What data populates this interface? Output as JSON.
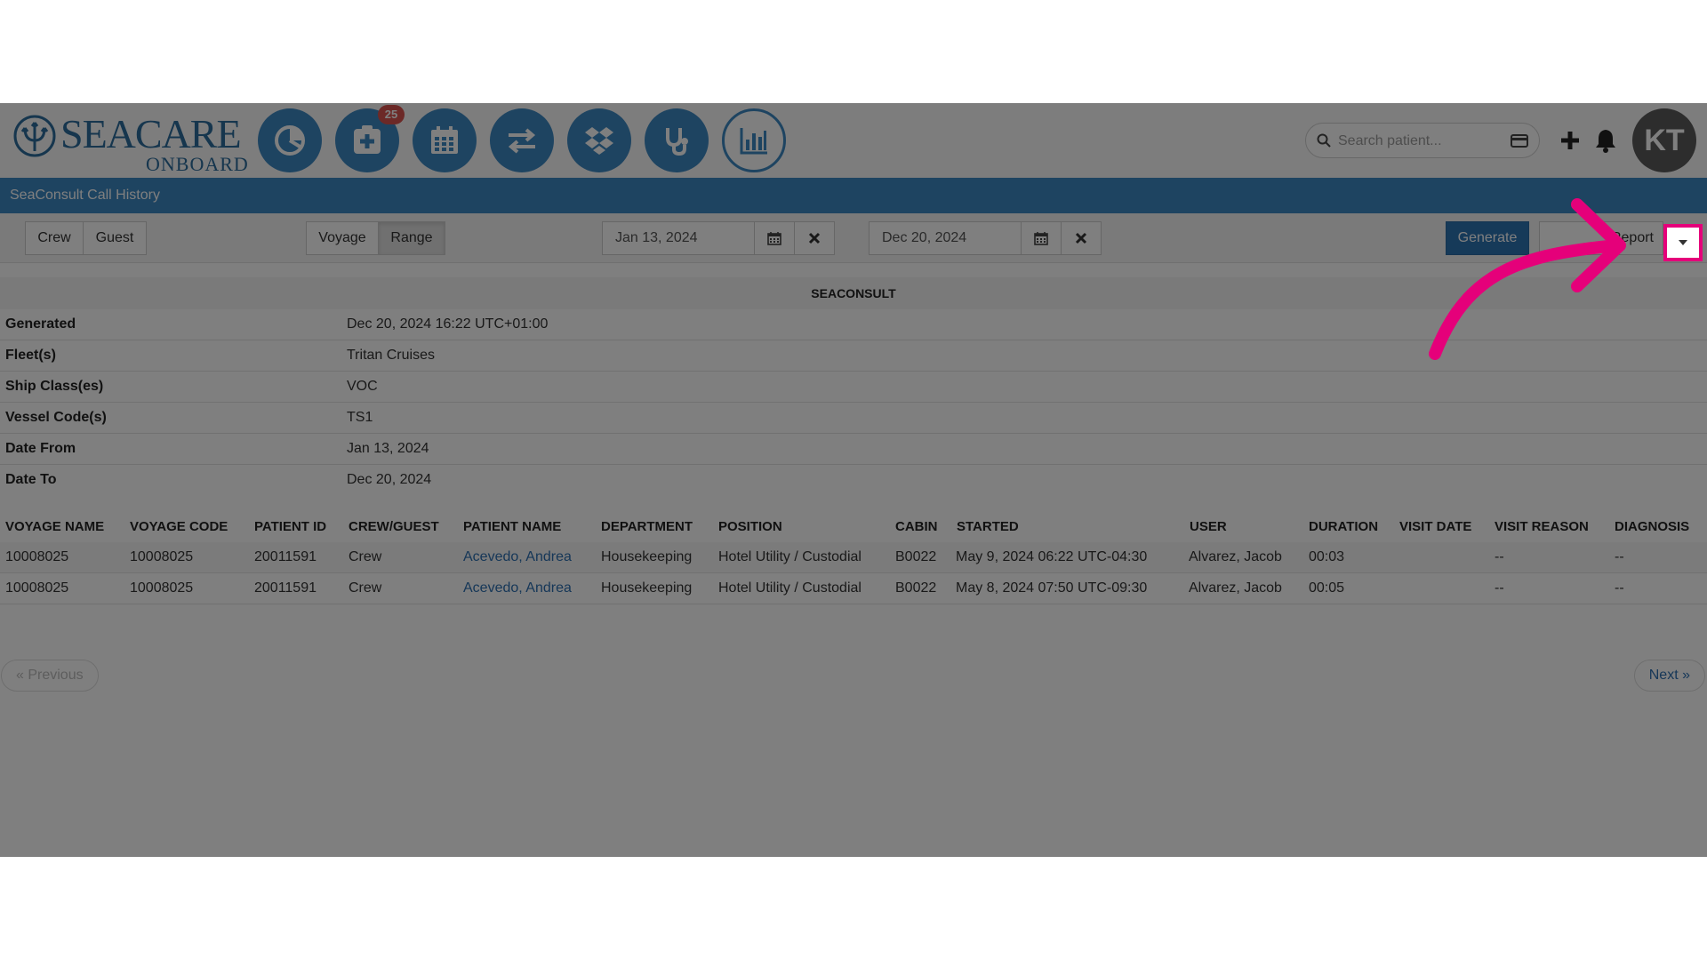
{
  "logo": {
    "text": "SEACARE",
    "subtext": "ONBOARD"
  },
  "nav": {
    "items": [
      {
        "icon": "dashboard-pie-icon"
      },
      {
        "icon": "medical-plus-icon",
        "badge": "25"
      },
      {
        "icon": "calendar-icon"
      },
      {
        "icon": "transfer-arrows-icon"
      },
      {
        "icon": "dropbox-icon"
      },
      {
        "icon": "stethoscope-icon"
      },
      {
        "icon": "bar-chart-icon"
      }
    ]
  },
  "search": {
    "placeholder": "Search patient..."
  },
  "user": {
    "initials": "KT"
  },
  "page": {
    "title": "SeaConsult Call History"
  },
  "filters": {
    "type_buttons": [
      "Crew",
      "Guest"
    ],
    "mode_buttons": [
      "Voyage",
      "Range"
    ],
    "date_from": "Jan 13, 2024",
    "date_to": "Dec 20, 2024",
    "generate_label": "Generate",
    "report_label": "Report"
  },
  "report": {
    "title": "SEACONSULT",
    "meta": [
      {
        "label": "Generated",
        "value": "Dec 20, 2024 16:22 UTC+01:00"
      },
      {
        "label": "Fleet(s)",
        "value": "Tritan Cruises"
      },
      {
        "label": "Ship Class(es)",
        "value": "VOC"
      },
      {
        "label": "Vessel Code(s)",
        "value": "TS1"
      },
      {
        "label": "Date From",
        "value": "Jan 13, 2024"
      },
      {
        "label": "Date To",
        "value": "Dec 20, 2024"
      }
    ]
  },
  "table": {
    "columns": [
      "VOYAGE NAME",
      "VOYAGE CODE",
      "PATIENT ID",
      "CREW/GUEST",
      "PATIENT NAME",
      "DEPARTMENT",
      "POSITION",
      "CABIN",
      "STARTED",
      "USER",
      "DURATION",
      "VISIT DATE",
      "VISIT REASON",
      "DIAGNOSIS"
    ],
    "rows": [
      [
        "10008025",
        "10008025",
        "20011591",
        "Crew",
        "Acevedo, Andrea",
        "Housekeeping",
        "Hotel Utility / Custodial",
        "B0022",
        "May 9, 2024 06:22 UTC-04:30",
        "Alvarez, Jacob",
        "00:03",
        "",
        "--",
        "--"
      ],
      [
        "10008025",
        "10008025",
        "20011591",
        "Crew",
        "Acevedo, Andrea",
        "Housekeeping",
        "Hotel Utility / Custodial",
        "B0022",
        "May 8, 2024 07:50 UTC-09:30",
        "Alvarez, Jacob",
        "00:05",
        "",
        "--",
        "--"
      ]
    ]
  },
  "pagination": {
    "previous": "« Previous",
    "next": "Next »"
  },
  "colors": {
    "brand": "#3d88c2",
    "annotation": "#e5007a",
    "badge": "#d9534f"
  }
}
